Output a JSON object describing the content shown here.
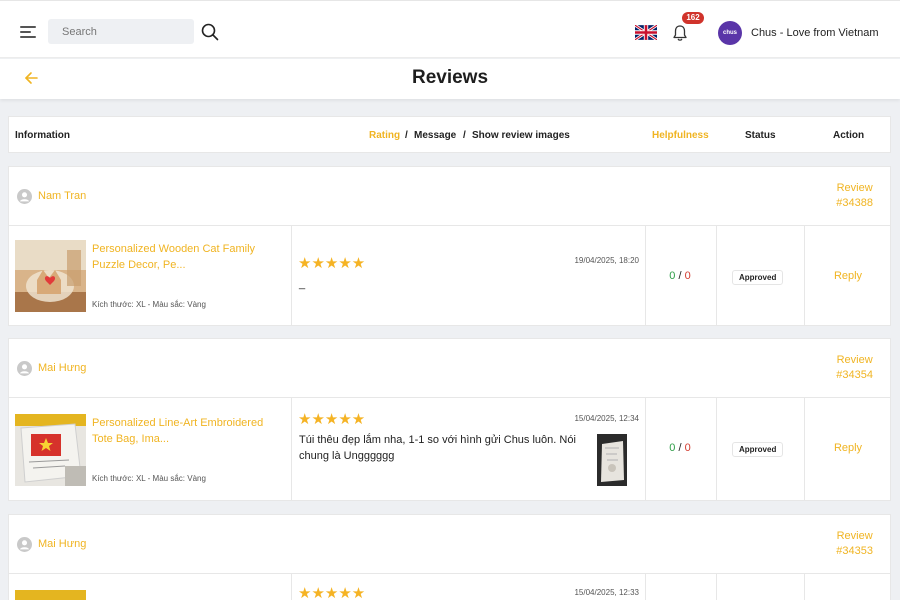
{
  "topbar": {
    "search_placeholder": "Search",
    "notification_count": "162",
    "avatar_text": "chus",
    "user_name": "Chus - Love from Vietnam"
  },
  "page": {
    "title": "Reviews"
  },
  "table_header": {
    "information": "Information",
    "rating": "Rating",
    "sep1": "/",
    "message": "Message",
    "sep2": "/",
    "show_images": "Show review images",
    "helpfulness": "Helpfulness",
    "status": "Status",
    "action": "Action"
  },
  "reviews": [
    {
      "user": "Nam Tran",
      "id_label": "Review",
      "id_num": "#34388",
      "product": "Personalized Wooden Cat Family Puzzle Decor, Pe...",
      "variant": "Kích thước: XL - Màu sắc: Vàng",
      "stars": "★★★★★",
      "date": "19/04/2025, 18:20",
      "message": "_",
      "helpful_yes": "0",
      "helpful_sep": "/",
      "helpful_no": "0",
      "status": "Approved",
      "action": "Reply"
    },
    {
      "user": "Mai Hưng",
      "id_label": "Review",
      "id_num": "#34354",
      "product": "Personalized Line-Art Embroidered Tote Bag, Ima...",
      "variant": "Kích thước: XL - Màu sắc: Vàng",
      "stars": "★★★★★",
      "date": "15/04/2025, 12:34",
      "message": "Túi thêu đẹp lắm nha, 1-1 so với hình gửi Chus luôn. Nói chung là Ungggggg",
      "helpful_yes": "0",
      "helpful_sep": "/",
      "helpful_no": "0",
      "status": "Approved",
      "action": "Reply"
    },
    {
      "user": "Mai Hưng",
      "id_label": "Review",
      "id_num": "#34353",
      "stars": "★★★★★",
      "date": "15/04/2025, 12:33"
    }
  ],
  "colors": {
    "accent": "#f0b422",
    "helpful_yes": "#2e9d47",
    "helpful_no": "#d23a2f",
    "avatar": "#5a35a8"
  }
}
